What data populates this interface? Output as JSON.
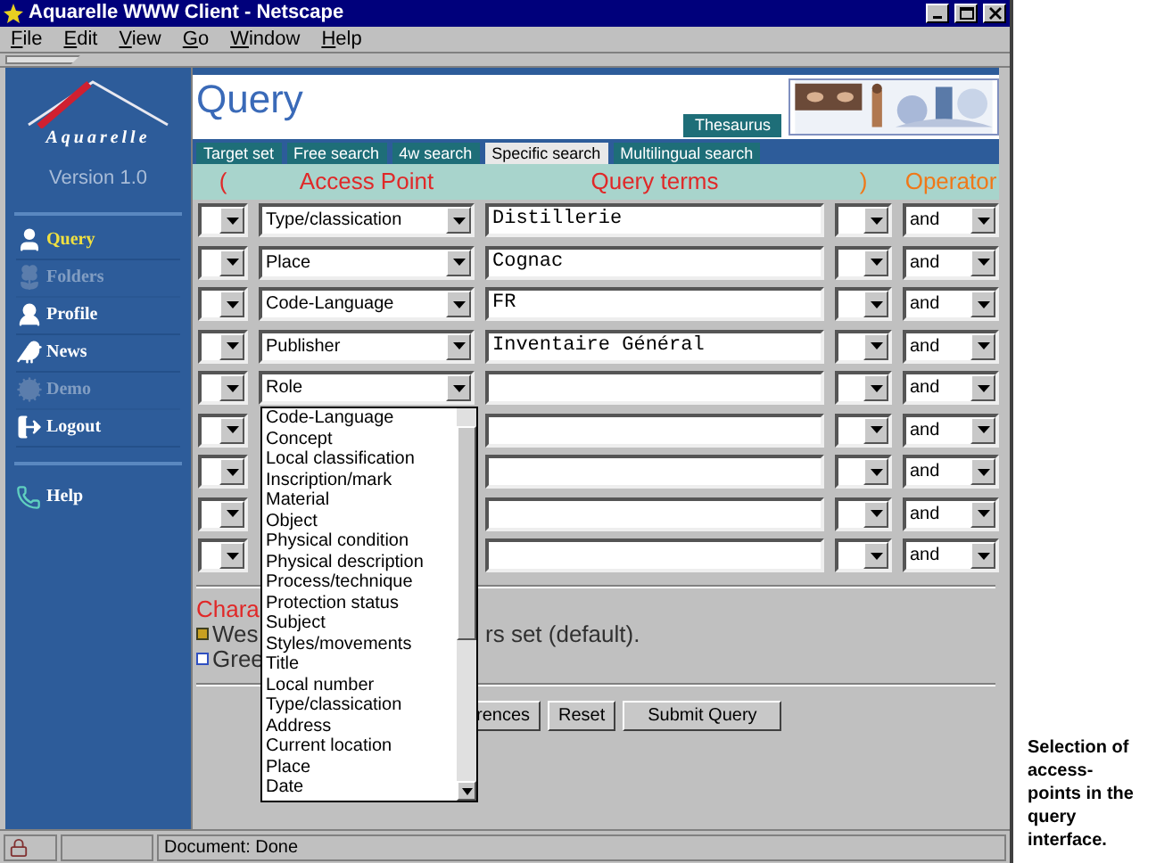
{
  "window": {
    "title": "Aquarelle WWW Client - Netscape"
  },
  "menu": [
    "File",
    "Edit",
    "View",
    "Go",
    "Window",
    "Help"
  ],
  "sidebar": {
    "logo": "Aquarelle",
    "version": "Version 1.0",
    "items": [
      {
        "label": "Query",
        "selected": true,
        "disabled": false
      },
      {
        "label": "Folders",
        "selected": false,
        "disabled": true
      },
      {
        "label": "Profile",
        "selected": false,
        "disabled": false
      },
      {
        "label": "News",
        "selected": false,
        "disabled": false
      },
      {
        "label": "Demo",
        "selected": false,
        "disabled": true
      },
      {
        "label": "Logout",
        "selected": false,
        "disabled": false
      }
    ],
    "help": "Help"
  },
  "page": {
    "title": "Query",
    "thesaurus_button": "Thesaurus",
    "tabs": [
      {
        "label": "Target set",
        "selected": false
      },
      {
        "label": "Free search",
        "selected": false
      },
      {
        "label": "4w search",
        "selected": false
      },
      {
        "label": "Specific search",
        "selected": true
      },
      {
        "label": "Multilingual search",
        "selected": false
      }
    ],
    "columns": [
      {
        "label": "(",
        "color": "#e02828"
      },
      {
        "label": "Access Point",
        "color": "#e02828"
      },
      {
        "label": "Query terms",
        "color": "#e02828"
      },
      {
        "label": ")",
        "color": "#f07818"
      },
      {
        "label": "Operator",
        "color": "#f07818"
      }
    ],
    "rows": [
      {
        "access_point": "Type/classication",
        "terms": "Distillerie",
        "operator": "and"
      },
      {
        "access_point": "Place",
        "terms": "Cognac",
        "operator": "and"
      },
      {
        "access_point": "Code-Language",
        "terms": "FR",
        "operator": "and"
      },
      {
        "access_point": "Publisher",
        "terms": "Inventaire Général",
        "operator": "and"
      },
      {
        "access_point": "Role",
        "terms": "",
        "operator": "and"
      },
      {
        "terms": "",
        "operator": "and"
      },
      {
        "terms": "",
        "operator": "and"
      },
      {
        "terms": "",
        "operator": "and"
      },
      {
        "terms": "",
        "operator": "and"
      }
    ],
    "dropdown": [
      "Code-Language",
      "Concept",
      "Local classification",
      "Inscription/mark",
      "Material",
      "Object",
      "Physical condition",
      "Physical description",
      "Process/technique",
      "Protection status",
      "Subject",
      "Styles/movements",
      "Title",
      "Local number",
      "Type/classication",
      "Address",
      "Current location",
      "Place",
      "Date"
    ],
    "charset": {
      "title": "Chara",
      "options": [
        {
          "start": "Wes",
          "end": "rs set (default).",
          "checked": true
        },
        {
          "start": "Gree",
          "checked": false
        }
      ]
    },
    "buttons": [
      "rences",
      "Reset",
      "Submit Query"
    ]
  },
  "status_bar": "Document: Done",
  "caption": "Selection of access-points in the query interface."
}
